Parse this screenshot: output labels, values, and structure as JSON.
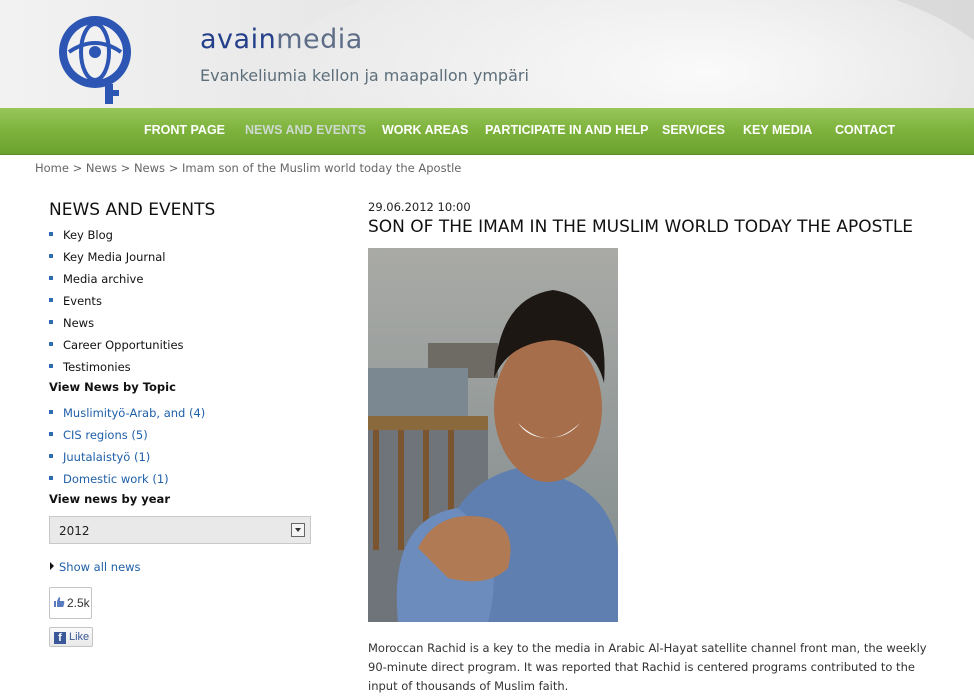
{
  "brand": {
    "name_part1": "avain",
    "name_part2": "media",
    "tagline": "Evankeliumia kellon ja maapallon ympäri"
  },
  "nav": [
    {
      "label": "FRONT PAGE",
      "active": false
    },
    {
      "label": "NEWS AND EVENTS",
      "active": true
    },
    {
      "label": "WORK AREAS",
      "active": false
    },
    {
      "label": "PARTICIPATE IN AND HELP",
      "active": false
    },
    {
      "label": "SERVICES",
      "active": false
    },
    {
      "label": "KEY MEDIA",
      "active": false
    },
    {
      "label": "CONTACT",
      "active": false
    }
  ],
  "breadcrumb": [
    "Home",
    "News",
    "News",
    "Imam son of the Muslim world today the Apostle"
  ],
  "breadcrumb_sep": ">",
  "sidebar": {
    "title": "NEWS AND EVENTS",
    "items": [
      "Key Blog",
      "Key Media Journal",
      "Media archive",
      "Events",
      "News",
      "Career Opportunities",
      "Testimonies"
    ],
    "topic_heading": "View News by Topic",
    "topics": [
      "Muslimityö-Arab, and (4)",
      "CIS regions (5)",
      "Juutalaistyö (1)",
      "Domestic work (1)"
    ],
    "year_heading": "View news by year",
    "year_selected": "2012",
    "show_all": "Show all news",
    "like_count": "2.5k",
    "like_label": "Like",
    "fb_glyph": "f"
  },
  "article": {
    "date": "29.06.2012 10:00",
    "title": "SON OF THE IMAM IN THE MUSLIM WORLD TODAY THE APOSTLE",
    "body": "Moroccan Rachid is a key to the media in Arabic Al-Hayat satellite channel front man, the weekly 90-minute direct program. It was reported that Rachid is centered programs contributed to the input of thousands of Muslim faith."
  },
  "colors": {
    "nav_green": "#7db23c",
    "link_blue": "#1f5fa8",
    "brand_blue": "#243f8a"
  }
}
